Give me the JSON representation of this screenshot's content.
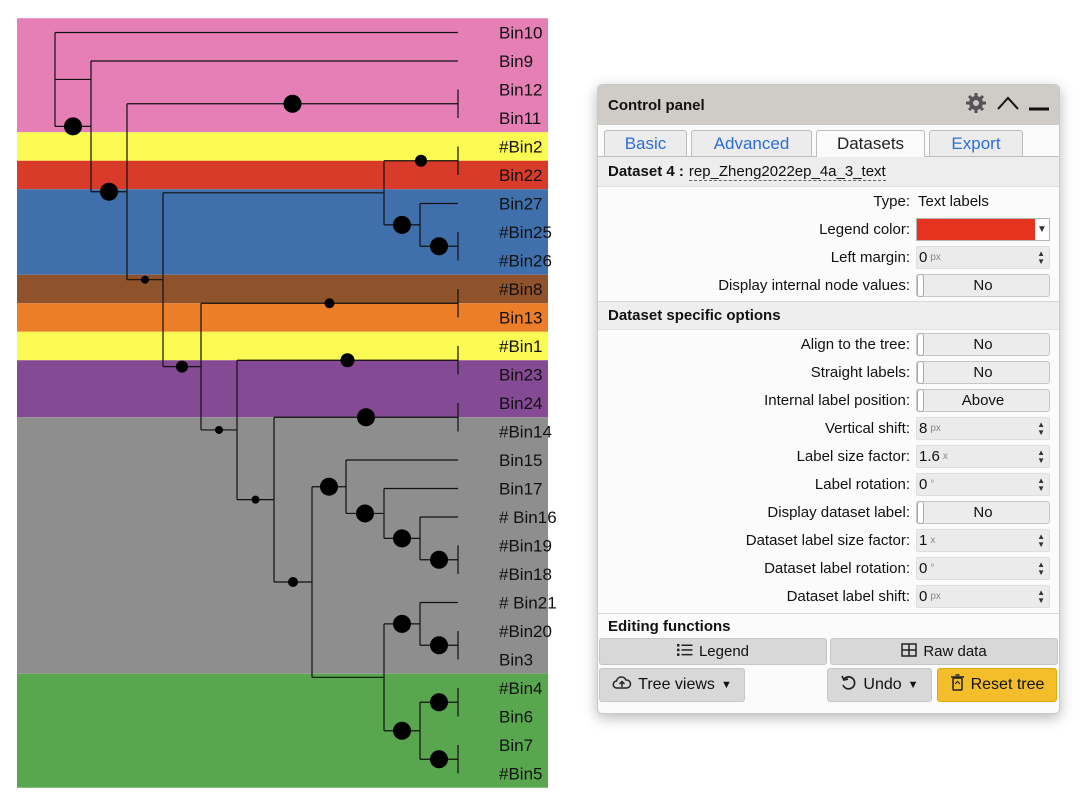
{
  "tree": {
    "leaves": [
      "Bin10",
      "Bin9",
      "Bin12",
      "Bin11",
      "#Bin2",
      "Bin22",
      "Bin27",
      "#Bin25",
      "#Bin26",
      "#Bin8",
      "Bin13",
      "#Bin1",
      "Bin23",
      "Bin24",
      "#Bin14",
      "Bin15",
      "Bin17",
      "# Bin16",
      "#Bin19",
      "#Bin18",
      "# Bin21",
      "#Bin20",
      "Bin3",
      "#Bin4",
      "Bin6",
      "Bin7",
      "#Bin5"
    ],
    "bands": [
      {
        "color": "#e57fb5",
        "from": 0,
        "to": 3
      },
      {
        "color": "#fafa53",
        "from": 4,
        "to": 4
      },
      {
        "color": "#d93b2b",
        "from": 5,
        "to": 5
      },
      {
        "color": "#4070ab",
        "from": 6,
        "to": 8
      },
      {
        "color": "#8f532b",
        "from": 9,
        "to": 9
      },
      {
        "color": "#ec7e2a",
        "from": 10,
        "to": 10
      },
      {
        "color": "#fafa53",
        "from": 11,
        "to": 11
      },
      {
        "color": "#844a93",
        "from": 12,
        "to": 13
      },
      {
        "color": "#8e8e8e",
        "from": 14,
        "to": 22
      },
      {
        "color": "#58a74f",
        "from": 23,
        "to": 26
      }
    ]
  },
  "panel": {
    "title": "Control panel",
    "icons": {
      "settings": "gear-icon",
      "collapse": "chevron-up-icon",
      "minimize": "minimize-icon"
    },
    "tabs": [
      "Basic",
      "Advanced",
      "Datasets",
      "Export"
    ],
    "active_tab": "Datasets",
    "dataset_prefix": "Dataset 4 :",
    "dataset_name": "rep_Zheng2022ep_4a_3_text",
    "rows": {
      "type": {
        "label": "Type:",
        "value": "Text labels"
      },
      "legend_color": {
        "label": "Legend color:",
        "color": "#e6331f"
      },
      "left_margin": {
        "label": "Left margin:",
        "value": "0",
        "unit": "px"
      },
      "internal_node": {
        "label": "Display internal node values:",
        "value": "No"
      }
    },
    "section_specific": "Dataset specific options",
    "specific_rows": {
      "align": {
        "label": "Align to the tree:",
        "value": "No"
      },
      "straight": {
        "label": "Straight labels:",
        "value": "No"
      },
      "internal_pos": {
        "label": "Internal label position:",
        "value": "Above"
      },
      "vshift": {
        "label": "Vertical shift:",
        "value": "8",
        "unit": "px"
      },
      "size_factor": {
        "label": "Label size factor:",
        "value": "1.6",
        "unit": "x"
      },
      "rotation": {
        "label": "Label rotation:",
        "value": "0",
        "unit": "°"
      },
      "display_ds": {
        "label": "Display dataset label:",
        "value": "No"
      },
      "ds_size": {
        "label": "Dataset label size factor:",
        "value": "1",
        "unit": "x"
      },
      "ds_rotation": {
        "label": "Dataset label rotation:",
        "value": "0",
        "unit": "°"
      },
      "ds_shift": {
        "label": "Dataset label shift:",
        "value": "0",
        "unit": "px"
      }
    },
    "section_editing": "Editing functions",
    "buttons": {
      "legend": "Legend",
      "raw_data": "Raw data",
      "tree_views": "Tree views",
      "undo": "Undo",
      "reset": "Reset tree"
    }
  }
}
